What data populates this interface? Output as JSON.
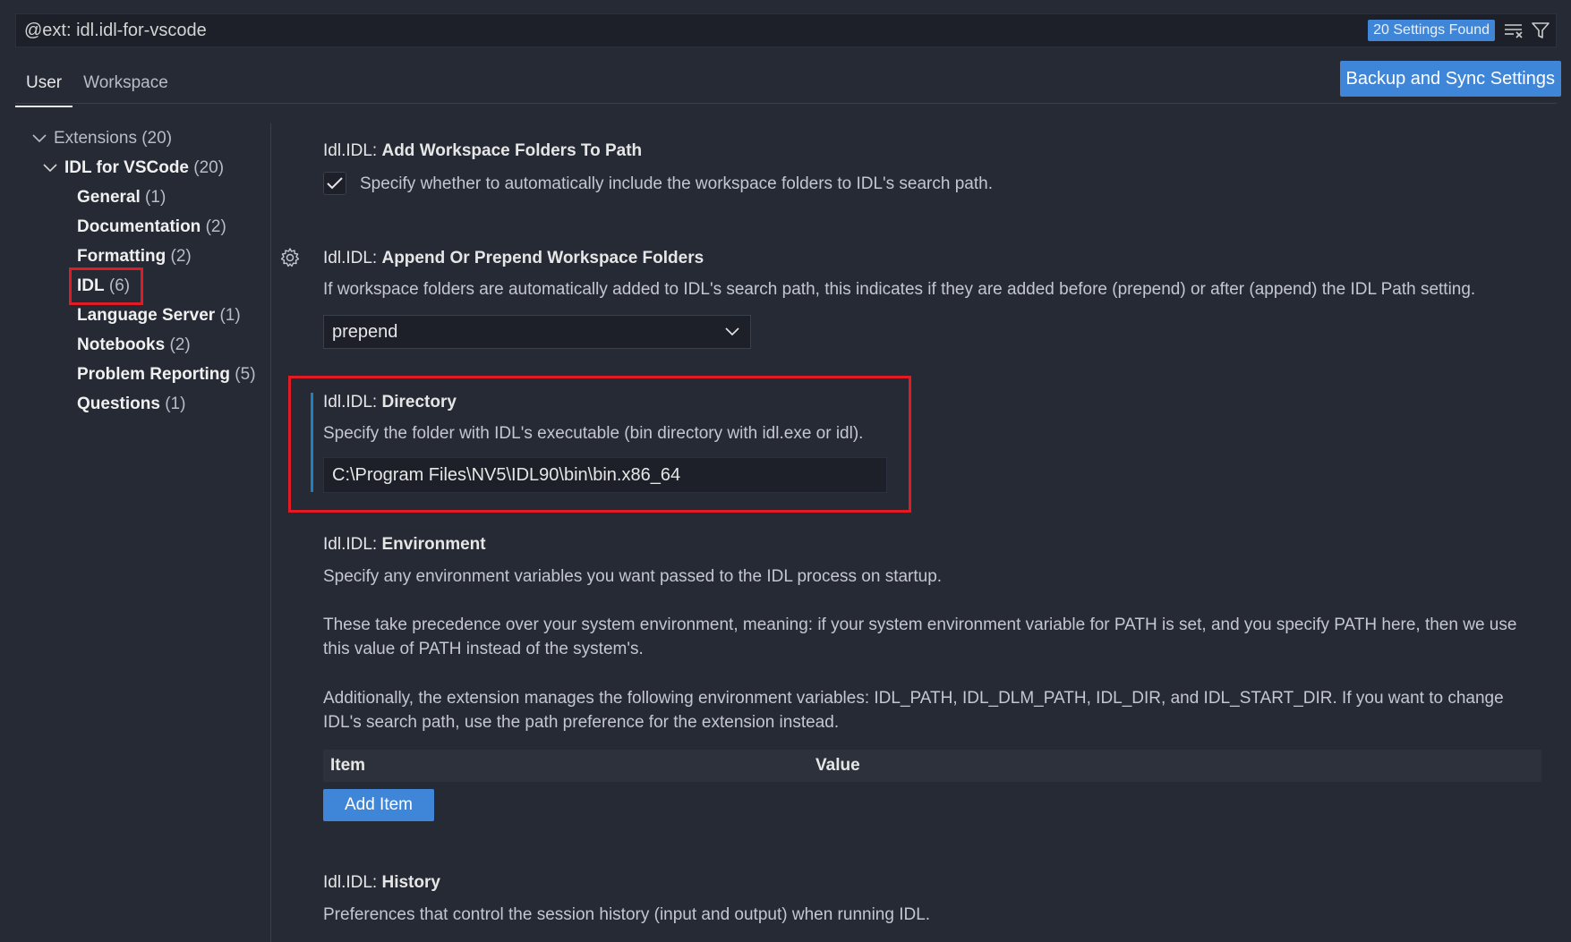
{
  "search": {
    "value": "@ext: idl.idl-for-vscode",
    "found_badge": "20 Settings Found",
    "clear_icon": "clear-filter-icon",
    "filter_icon": "filter-icon"
  },
  "tabs": [
    {
      "label": "User",
      "active": true
    },
    {
      "label": "Workspace",
      "active": false
    }
  ],
  "sync_button": "Backup and Sync Settings",
  "tree": {
    "extensions": {
      "name": "Extensions",
      "count": "(20)"
    },
    "idl_vscode": {
      "name": "IDL for VSCode",
      "count": "(20)"
    },
    "items": [
      {
        "name": "General",
        "count": "(1)"
      },
      {
        "name": "Documentation",
        "count": "(2)"
      },
      {
        "name": "Formatting",
        "count": "(2)"
      },
      {
        "name": "IDL",
        "count": "(6)"
      },
      {
        "name": "Language Server",
        "count": "(1)"
      },
      {
        "name": "Notebooks",
        "count": "(2)"
      },
      {
        "name": "Problem Reporting",
        "count": "(5)"
      },
      {
        "name": "Questions",
        "count": "(1)"
      }
    ]
  },
  "settings": {
    "add_folders": {
      "prefix": "Idl.IDL: ",
      "key": "Add Workspace Folders To Path",
      "description": "Specify whether to automatically include the workspace folders to IDL's search path.",
      "checked": true
    },
    "append_prepend": {
      "prefix": "Idl.IDL: ",
      "key": "Append Or Prepend Workspace Folders",
      "description": "If workspace folders are automatically added to IDL's search path, this indicates if they are added before (prepend) or after (append) the IDL Path setting.",
      "value": "prepend"
    },
    "directory": {
      "prefix": "Idl.IDL: ",
      "key": "Directory",
      "description": "Specify the folder with IDL's executable (bin directory with idl.exe or idl).",
      "value": "C:\\Program Files\\NV5\\IDL90\\bin\\bin.x86_64"
    },
    "environment": {
      "prefix": "Idl.IDL: ",
      "key": "Environment",
      "description_1": "Specify any environment variables you want passed to the IDL process on startup.",
      "description_2": "These take precedence over your system environment, meaning: if your system environment variable for PATH is set, and you specify PATH here, then we use this value of PATH instead of the system's.",
      "description_3": "Additionally, the extension manages the following environment variables: IDL_PATH, IDL_DLM_PATH, IDL_DIR, and IDL_START_DIR. If you want to change IDL's search path, use the path preference for the extension instead.",
      "col_item": "Item",
      "col_value": "Value",
      "add_button": "Add Item"
    },
    "history": {
      "prefix": "Idl.IDL: ",
      "key": "History",
      "description": "Preferences that control the session history (input and output) when running IDL."
    }
  },
  "colors": {
    "background": "#252a35",
    "accent": "#3f86d9",
    "highlight": "#e01b24",
    "focus": "#1f7fc0"
  }
}
